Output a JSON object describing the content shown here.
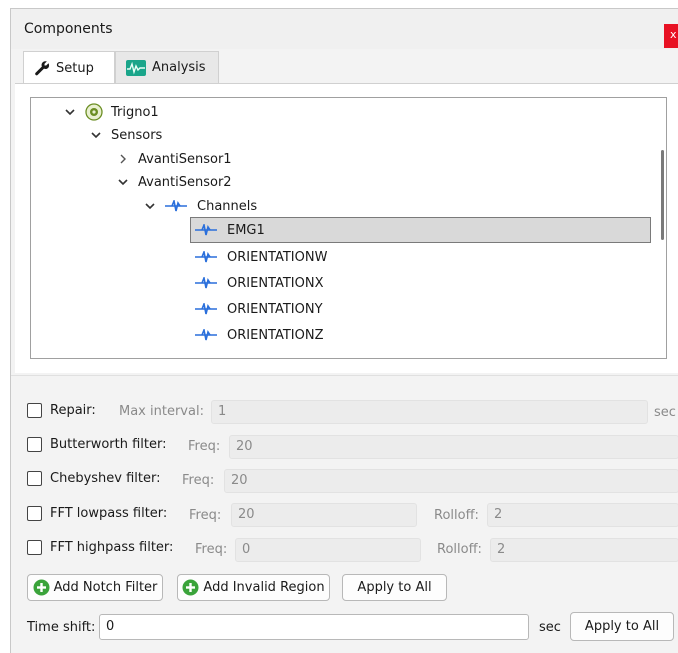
{
  "window": {
    "title": "Components",
    "close_glyph": "x"
  },
  "tabs": [
    {
      "label": "Setup",
      "icon": "wrench-icon",
      "active": true
    },
    {
      "label": "Analysis",
      "icon": "analysis-icon",
      "active": false
    }
  ],
  "tree": {
    "nodes": [
      {
        "label": "Trigno1",
        "expander": "expanded",
        "icon": "device-icon"
      },
      {
        "label": "Sensors",
        "expander": "expanded"
      },
      {
        "label": "AvantiSensor1",
        "expander": "collapsed"
      },
      {
        "label": "AvantiSensor2",
        "expander": "expanded"
      },
      {
        "label": "Channels",
        "expander": "expanded",
        "icon": "channel-icon"
      },
      {
        "label": "EMG1",
        "icon": "channel-icon",
        "selected": true
      },
      {
        "label": "ORIENTATIONW",
        "icon": "channel-icon"
      },
      {
        "label": "ORIENTATIONX",
        "icon": "channel-icon"
      },
      {
        "label": "ORIENTATIONY",
        "icon": "channel-icon"
      },
      {
        "label": "ORIENTATIONZ",
        "icon": "channel-icon"
      }
    ]
  },
  "filters": {
    "repair": {
      "label": "Repair:",
      "field_label": "Max interval:",
      "value": "1",
      "unit": "sec"
    },
    "butterworth": {
      "label": "Butterworth filter:",
      "field_label": "Freq:",
      "value": "20"
    },
    "chebyshev": {
      "label": "Chebyshev filter:",
      "field_label": "Freq:",
      "value": "20"
    },
    "fft_lowpass": {
      "label": "FFT lowpass filter:",
      "freq_label": "Freq:",
      "freq_value": "20",
      "rolloff_label": "Rolloff:",
      "rolloff_value": "2"
    },
    "fft_highpass": {
      "label": "FFT highpass filter:",
      "freq_label": "Freq:",
      "freq_value": "0",
      "rolloff_label": "Rolloff:",
      "rolloff_value": "2"
    }
  },
  "actions": {
    "add_notch": "Add Notch Filter",
    "add_invalid_region": "Add Invalid Region",
    "apply_all_filters": "Apply to All"
  },
  "time_shift": {
    "label": "Time shift:",
    "value": "0",
    "unit": "sec",
    "apply_label": "Apply to All"
  },
  "colors": {
    "accent_blue": "#2a6fdb",
    "add_green": "#3aa33a",
    "close_red": "#e81123",
    "analysis_teal": "#1aa58a"
  }
}
